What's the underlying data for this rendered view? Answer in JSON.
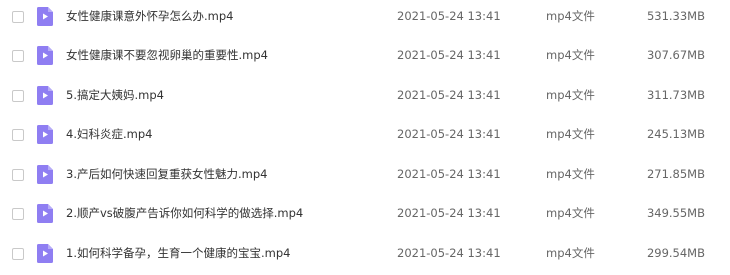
{
  "colors": {
    "icon_fill": "#8f7ef2",
    "icon_fold": "#b7acf7",
    "icon_play": "#ffffff",
    "checkbox_border": "#c9c9c9"
  },
  "icons": {
    "file": "video-file-icon"
  },
  "files": [
    {
      "name": "女性健康课意外怀孕怎么办.mp4",
      "modified": "2021-05-24 13:41",
      "type": "mp4文件",
      "size": "531.33MB"
    },
    {
      "name": "女性健康课不要忽视卵巢的重要性.mp4",
      "modified": "2021-05-24 13:41",
      "type": "mp4文件",
      "size": "307.67MB"
    },
    {
      "name": "5.搞定大姨妈.mp4",
      "modified": "2021-05-24 13:41",
      "type": "mp4文件",
      "size": "311.73MB"
    },
    {
      "name": "4.妇科炎症.mp4",
      "modified": "2021-05-24 13:41",
      "type": "mp4文件",
      "size": "245.13MB"
    },
    {
      "name": "3.产后如何快速回复重获女性魅力.mp4",
      "modified": "2021-05-24 13:41",
      "type": "mp4文件",
      "size": "271.85MB"
    },
    {
      "name": "2.顺产vs破腹产告诉你如何科学的做选择.mp4",
      "modified": "2021-05-24 13:41",
      "type": "mp4文件",
      "size": "349.55MB"
    },
    {
      "name": "1.如何科学备孕，生育一个健康的宝宝.mp4",
      "modified": "2021-05-24 13:41",
      "type": "mp4文件",
      "size": "299.54MB"
    }
  ]
}
